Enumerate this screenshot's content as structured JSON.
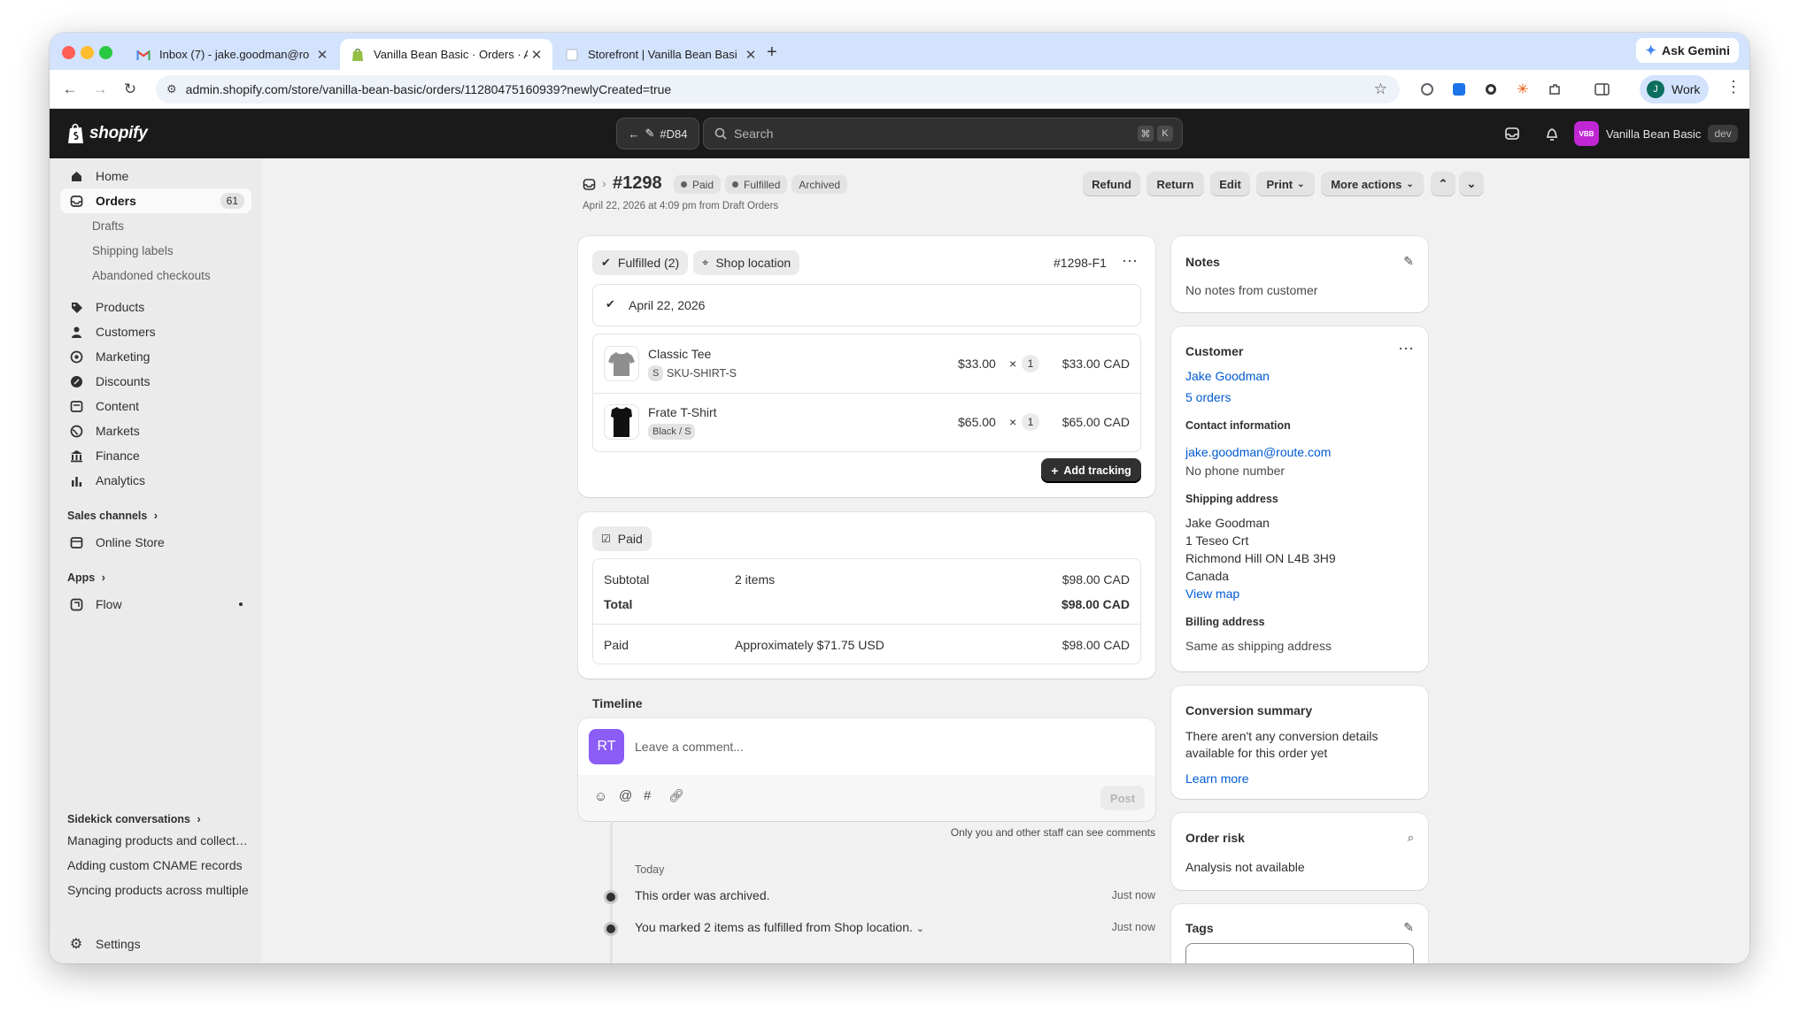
{
  "browser": {
    "tabs": [
      {
        "title": "Inbox (7) - jake.goodman@ro",
        "favicon": "gmail-icon"
      },
      {
        "title": "Vanilla Bean Basic · Orders · A",
        "favicon": "shopify-icon"
      },
      {
        "title": "Storefront | Vanilla Bean Basi",
        "favicon": "page-icon"
      }
    ],
    "new_tab": "+",
    "ask_gemini": "Ask Gemini",
    "url": "admin.shopify.com/store/vanilla-bean-basic/orders/11280475160939?newlyCreated=true",
    "profile_initial": "J",
    "profile_name": "Work"
  },
  "topbar": {
    "brand": "shopify",
    "back_label": "#D84",
    "search_placeholder": "Search",
    "kbd_cmd": "⌘",
    "kbd_k": "K",
    "store_badge": "VBB",
    "store_name": "Vanilla Bean Basic",
    "store_tag": "dev"
  },
  "sidebar": {
    "home": "Home",
    "orders": "Orders",
    "orders_count": "61",
    "drafts": "Drafts",
    "shipping_labels": "Shipping labels",
    "abandoned": "Abandoned checkouts",
    "products": "Products",
    "customers": "Customers",
    "marketing": "Marketing",
    "discounts": "Discounts",
    "content": "Content",
    "markets": "Markets",
    "finance": "Finance",
    "analytics": "Analytics",
    "sales_channels": "Sales channels",
    "online_store": "Online Store",
    "apps": "Apps",
    "flow": "Flow",
    "sidekick": "Sidekick conversations",
    "conversations": [
      "Managing products and collections",
      "Adding custom CNAME records",
      "Syncing products across multiple"
    ],
    "settings": "Settings"
  },
  "order": {
    "number": "#1298",
    "status_paid": "Paid",
    "status_fulfilled": "Fulfilled",
    "status_archived": "Archived",
    "date_line": "April 22, 2026 at 4:09 pm from Draft Orders",
    "actions": {
      "refund": "Refund",
      "return": "Return",
      "edit": "Edit",
      "print": "Print",
      "more": "More actions"
    }
  },
  "fulfillment": {
    "badge": "Fulfilled (2)",
    "location": "Shop location",
    "id": "#1298-F1",
    "date": "April 22, 2026",
    "items": [
      {
        "name": "Classic Tee",
        "variant_tag": "S",
        "variant": "SKU-SHIRT-S",
        "price": "$33.00",
        "times": "×",
        "qty": "1",
        "total": "$33.00 CAD"
      },
      {
        "name": "Frate T-Shirt",
        "variant_tag": "",
        "variant": "Black / S",
        "price": "$65.00",
        "times": "×",
        "qty": "1",
        "total": "$65.00 CAD"
      }
    ],
    "add_tracking": "Add tracking"
  },
  "payment": {
    "badge": "Paid",
    "subtotal_label": "Subtotal",
    "subtotal_items": "2 items",
    "subtotal_value": "$98.00 CAD",
    "total_label": "Total",
    "total_value": "$98.00 CAD",
    "paid_label": "Paid",
    "paid_note": "Approximately $71.75 USD",
    "paid_value": "$98.00 CAD"
  },
  "timeline": {
    "title": "Timeline",
    "avatar": "RT",
    "placeholder": "Leave a comment...",
    "post": "Post",
    "note": "Only you and other staff can see comments",
    "day": "Today",
    "events": [
      {
        "text": "This order was archived.",
        "time": "Just now"
      },
      {
        "text": "You marked 2 items as fulfilled from Shop location.",
        "time": "Just now"
      }
    ]
  },
  "notes": {
    "title": "Notes",
    "text": "No notes from customer"
  },
  "customer": {
    "title": "Customer",
    "name": "Jake Goodman",
    "orders": "5 orders",
    "contact_title": "Contact information",
    "email": "jake.goodman@route.com",
    "phone": "No phone number",
    "shipping_title": "Shipping address",
    "address": [
      "Jake Goodman",
      "1 Teseo Crt",
      "Richmond Hill ON L4B 3H9",
      "Canada"
    ],
    "view_map": "View map",
    "billing_title": "Billing address",
    "billing": "Same as shipping address"
  },
  "conversion": {
    "title": "Conversion summary",
    "text1": "There aren't any conversion details",
    "text2": "available for this order yet",
    "link": "Learn more"
  },
  "risk": {
    "title": "Order risk",
    "text": "Analysis not available"
  },
  "tags": {
    "title": "Tags"
  },
  "colors": {
    "accent": "#005bd3",
    "topbar": "#1a1a1a",
    "avatar": "#8b5cf6",
    "store_badge": "#c026d3"
  }
}
